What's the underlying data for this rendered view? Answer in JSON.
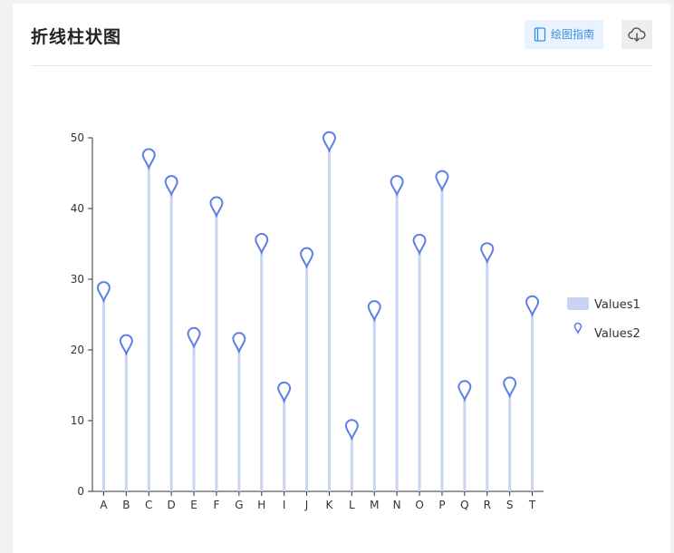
{
  "header": {
    "title": "折线柱状图",
    "guide_label": "绘图指南"
  },
  "icons": {
    "guide": "book-icon",
    "download": "cloud-download-icon"
  },
  "colors": {
    "bar": "#c9d3f3",
    "marker": "#5b7fe6",
    "accent": "#3d8fe0"
  },
  "chart_data": {
    "type": "bar",
    "categories": [
      "A",
      "B",
      "C",
      "D",
      "E",
      "F",
      "G",
      "H",
      "I",
      "J",
      "K",
      "L",
      "M",
      "N",
      "O",
      "P",
      "Q",
      "R",
      "S",
      "T"
    ],
    "series": [
      {
        "name": "Values1",
        "type": "bar",
        "values": [
          28,
          20.5,
          46.8,
          43,
          21.5,
          40,
          20.8,
          34.8,
          13.8,
          32.8,
          49.2,
          8.5,
          25.3,
          43,
          34.7,
          43.7,
          14,
          33.5,
          14.5,
          26
        ]
      },
      {
        "name": "Values2",
        "type": "pin",
        "values": [
          28,
          20.5,
          46.8,
          43,
          21.5,
          40,
          20.8,
          34.8,
          13.8,
          32.8,
          49.2,
          8.5,
          25.3,
          43,
          34.7,
          43.7,
          14,
          33.5,
          14.5,
          26
        ]
      }
    ],
    "ylim": [
      0,
      50
    ],
    "yticks": [
      0,
      10,
      20,
      30,
      40,
      50
    ],
    "grid": false,
    "legend": "right"
  }
}
